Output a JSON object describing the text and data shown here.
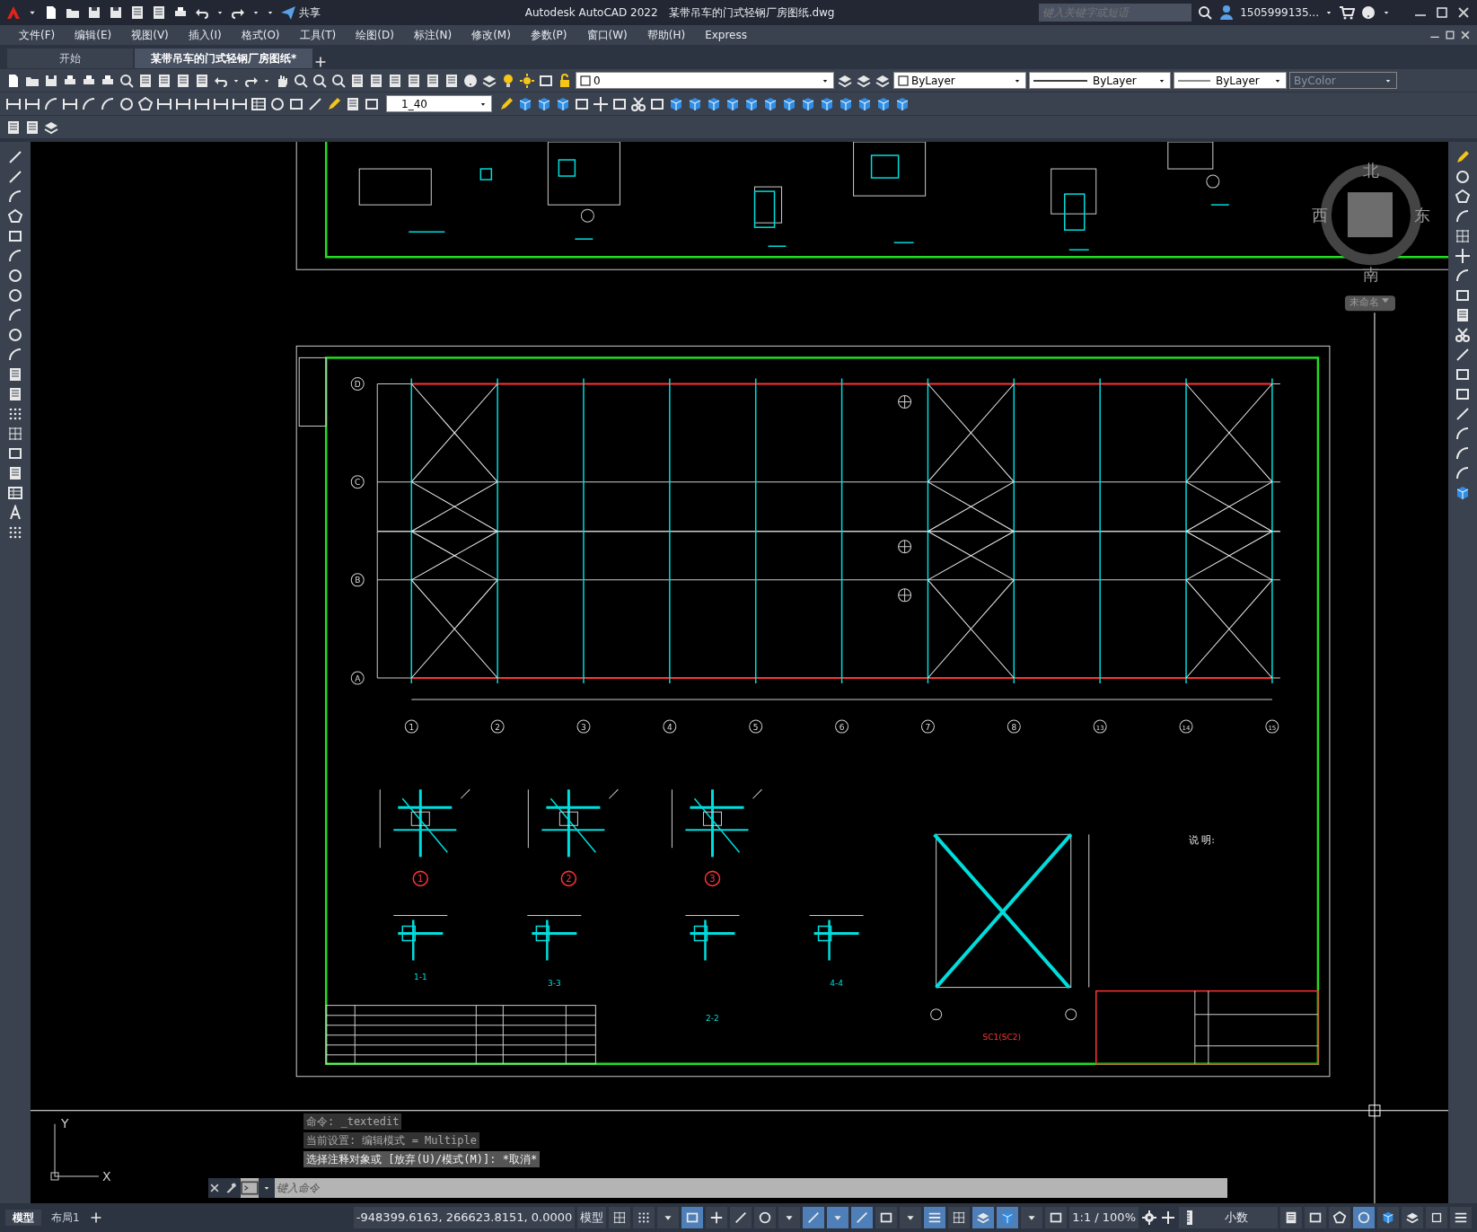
{
  "title_bar": {
    "app_title": "Autodesk AutoCAD 2022",
    "file_name": "某带吊车的门式轻钢厂房图纸.dwg",
    "share": "共享",
    "search": {
      "placeholder": "键入关键字或短语"
    },
    "user": "1505999135..."
  },
  "menu": [
    "文件(F)",
    "编辑(E)",
    "视图(V)",
    "插入(I)",
    "格式(O)",
    "工具(T)",
    "绘图(D)",
    "标注(N)",
    "修改(M)",
    "参数(P)",
    "窗口(W)",
    "帮助(H)",
    "Express"
  ],
  "doc_tabs": [
    {
      "label": "开始",
      "selected": false
    },
    {
      "label": "某带吊车的门式轻钢厂房图纸*",
      "selected": true
    }
  ],
  "properties": {
    "layer": "0",
    "color_setting": "ByLayer",
    "linetype": "ByLayer",
    "lineweight": "ByLayer",
    "plot_style": "ByColor",
    "dim_style": "1_40"
  },
  "viewcube": {
    "north": "北",
    "south": "南",
    "east": "东",
    "west": "西",
    "ucs": "未命名"
  },
  "drawing": {
    "columns": [
      {
        "label": "1",
        "braced_bay": true
      },
      {
        "label": "2",
        "braced_bay": false
      },
      {
        "label": "3",
        "braced_bay": false
      },
      {
        "label": "4",
        "braced_bay": false
      },
      {
        "label": "5",
        "braced_bay": false
      },
      {
        "label": "6",
        "braced_bay": false
      },
      {
        "label": "7",
        "braced_bay": true
      },
      {
        "label": "8",
        "braced_bay": false
      },
      {
        "label": "13",
        "braced_bay": false
      },
      {
        "label": "14",
        "braced_bay": true
      },
      {
        "label": "15",
        "braced_bay": false
      }
    ],
    "rows": [
      "D",
      "C",
      "B",
      "A"
    ],
    "detail_marks": [
      "1",
      "2",
      "3"
    ],
    "section_labels": [
      "1-1",
      "3-3",
      "2-2",
      "4-4"
    ],
    "brace_label": "SC1(SC2)",
    "notes_title": "说 明:"
  },
  "ucs_icon": {
    "x": "X",
    "y": "Y"
  },
  "command_history": [
    "命令: _textedit",
    "当前设置: 编辑模式 = Multiple",
    "选择注释对象或 [放弃(U)/模式(M)]: *取消*"
  ],
  "command_line": {
    "placeholder": "键入命令"
  },
  "layout_tabs": [
    {
      "label": "模型",
      "selected": true
    },
    {
      "label": "布局1",
      "selected": false
    }
  ],
  "status_bar": {
    "coordinates": "-948399.6163, 266623.8151, 0.0000",
    "space": "模型",
    "annotation_scale": "1:1 / 100%",
    "units": "小数",
    "toggles": [
      {
        "on": false
      },
      {
        "on": false
      },
      {
        "on": false
      },
      {
        "on": true
      },
      {
        "on": false
      },
      {
        "on": false
      },
      {
        "on": false
      },
      {
        "on": false
      },
      {
        "on": true
      },
      {
        "on": true
      },
      {
        "on": true
      },
      {
        "on": false
      },
      {
        "on": false
      },
      {
        "on": true
      },
      {
        "on": false
      },
      {
        "on": true
      },
      {
        "on": true
      },
      {
        "on": false
      },
      {
        "on": false
      }
    ],
    "right_toggles": [
      {
        "on": false
      },
      {
        "on": false
      },
      {
        "on": false
      },
      {
        "on": true
      },
      {
        "on": false
      },
      {
        "on": false
      },
      {
        "on": false
      },
      {
        "on": false
      }
    ]
  }
}
